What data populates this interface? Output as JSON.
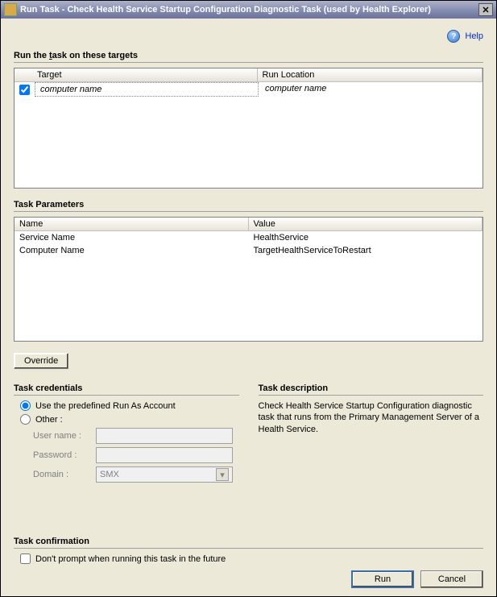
{
  "window": {
    "title": "Run Task - Check Health Service Startup Configuration Diagnostic Task (used by Health Explorer)"
  },
  "help": {
    "label": "Help"
  },
  "targets": {
    "section_label": "Run the task on these targets",
    "col_target": "Target",
    "col_location": "Run Location",
    "rows": [
      {
        "target": "computer name",
        "location": "computer name",
        "checked": true
      }
    ]
  },
  "params": {
    "section_label": "Task Parameters",
    "col_name": "Name",
    "col_value": "Value",
    "rows": [
      {
        "name": "Service Name",
        "value": "HealthService"
      },
      {
        "name": "Computer Name",
        "value": "TargetHealthServiceToRestart"
      }
    ]
  },
  "override_label": "Override",
  "credentials": {
    "section_label": "Task credentials",
    "opt_predefined": "Use the predefined Run As Account",
    "opt_other": "Other :",
    "username_label": "User name :",
    "password_label": "Password :",
    "domain_label": "Domain :",
    "domain_value": "SMX"
  },
  "description": {
    "section_label": "Task description",
    "text": "Check Health Service Startup Configuration diagnostic task that runs from the Primary Management Server of a Health Service."
  },
  "confirmation": {
    "section_label": "Task confirmation",
    "dont_prompt": "Don't prompt when running this task in the future"
  },
  "buttons": {
    "run": "Run",
    "cancel": "Cancel"
  }
}
